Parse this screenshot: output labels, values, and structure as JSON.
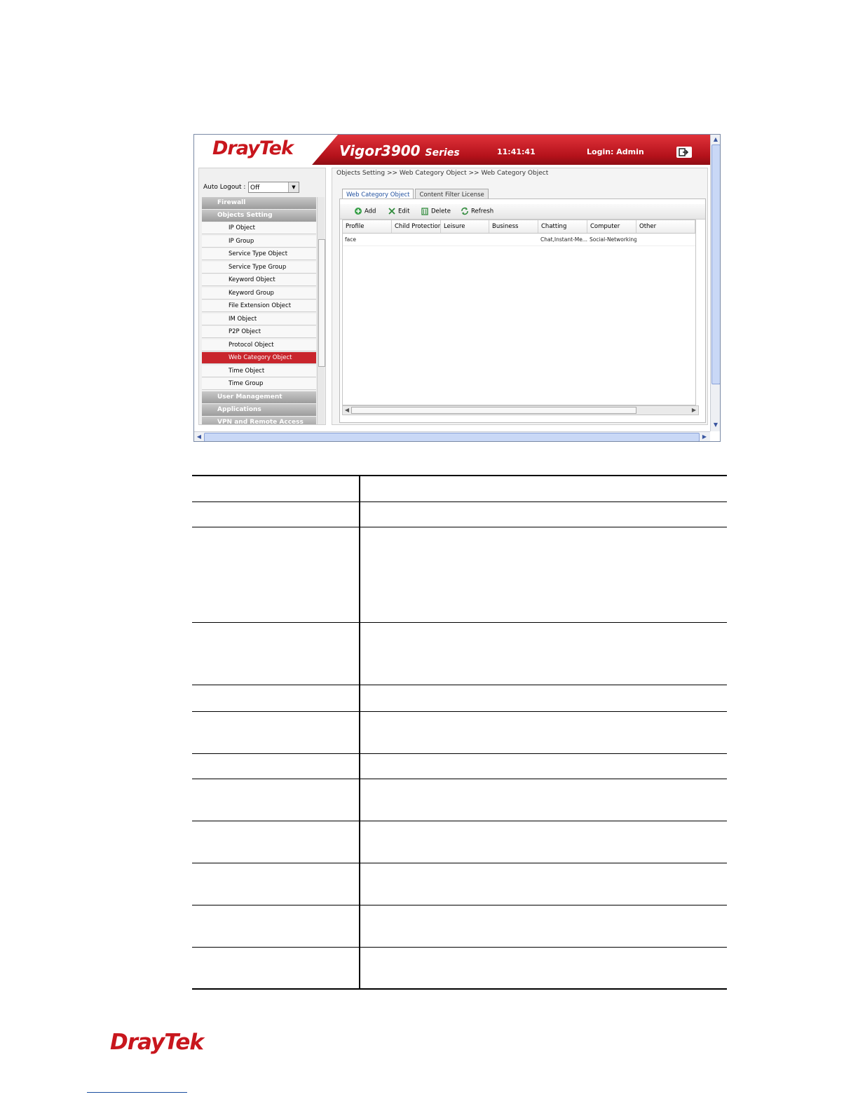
{
  "header": {
    "logo": "DrayTek",
    "product": "Vigor3900",
    "product_suffix": "Series",
    "clock": "11:41:41",
    "login": "Login: Admin"
  },
  "sidebar": {
    "auto_logout_label": "Auto Logout :",
    "auto_logout_value": "Off",
    "items": [
      {
        "label": "Firewall",
        "type": "category"
      },
      {
        "label": "Objects Setting",
        "type": "category"
      },
      {
        "label": "IP Object",
        "type": "item"
      },
      {
        "label": "IP Group",
        "type": "item"
      },
      {
        "label": "Service Type Object",
        "type": "item"
      },
      {
        "label": "Service Type Group",
        "type": "item"
      },
      {
        "label": "Keyword Object",
        "type": "item"
      },
      {
        "label": "Keyword Group",
        "type": "item"
      },
      {
        "label": "File Extension Object",
        "type": "item"
      },
      {
        "label": "IM Object",
        "type": "item"
      },
      {
        "label": "P2P Object",
        "type": "item"
      },
      {
        "label": "Protocol Object",
        "type": "item"
      },
      {
        "label": "Web Category Object",
        "type": "item",
        "active": true
      },
      {
        "label": "Time Object",
        "type": "item"
      },
      {
        "label": "Time Group",
        "type": "item"
      },
      {
        "label": "User Management",
        "type": "category"
      },
      {
        "label": "Applications",
        "type": "category"
      },
      {
        "label": "VPN and Remote Access",
        "type": "category"
      }
    ]
  },
  "main": {
    "breadcrumb": "Objects Setting >> Web Category Object >> Web Category Object",
    "tabs": [
      {
        "label": "Web Category Object",
        "active": true
      },
      {
        "label": "Content Filter License",
        "active": false
      }
    ],
    "toolbar": {
      "add": "Add",
      "edit": "Edit",
      "delete": "Delete",
      "refresh": "Refresh"
    },
    "grid": {
      "columns": [
        "Profile",
        "Child Protection",
        "Leisure",
        "Business",
        "Chatting",
        "Computer",
        "Other"
      ],
      "rows": [
        [
          "face",
          "",
          "",
          "",
          "Chat,Instant-Me...",
          "Social-Networking",
          ""
        ]
      ]
    }
  },
  "footer": {
    "logo": "DrayTek"
  },
  "colors": {
    "brand_red": "#c8161d",
    "active_menu": "#c9252c",
    "tab_text": "#1f4f9e"
  }
}
